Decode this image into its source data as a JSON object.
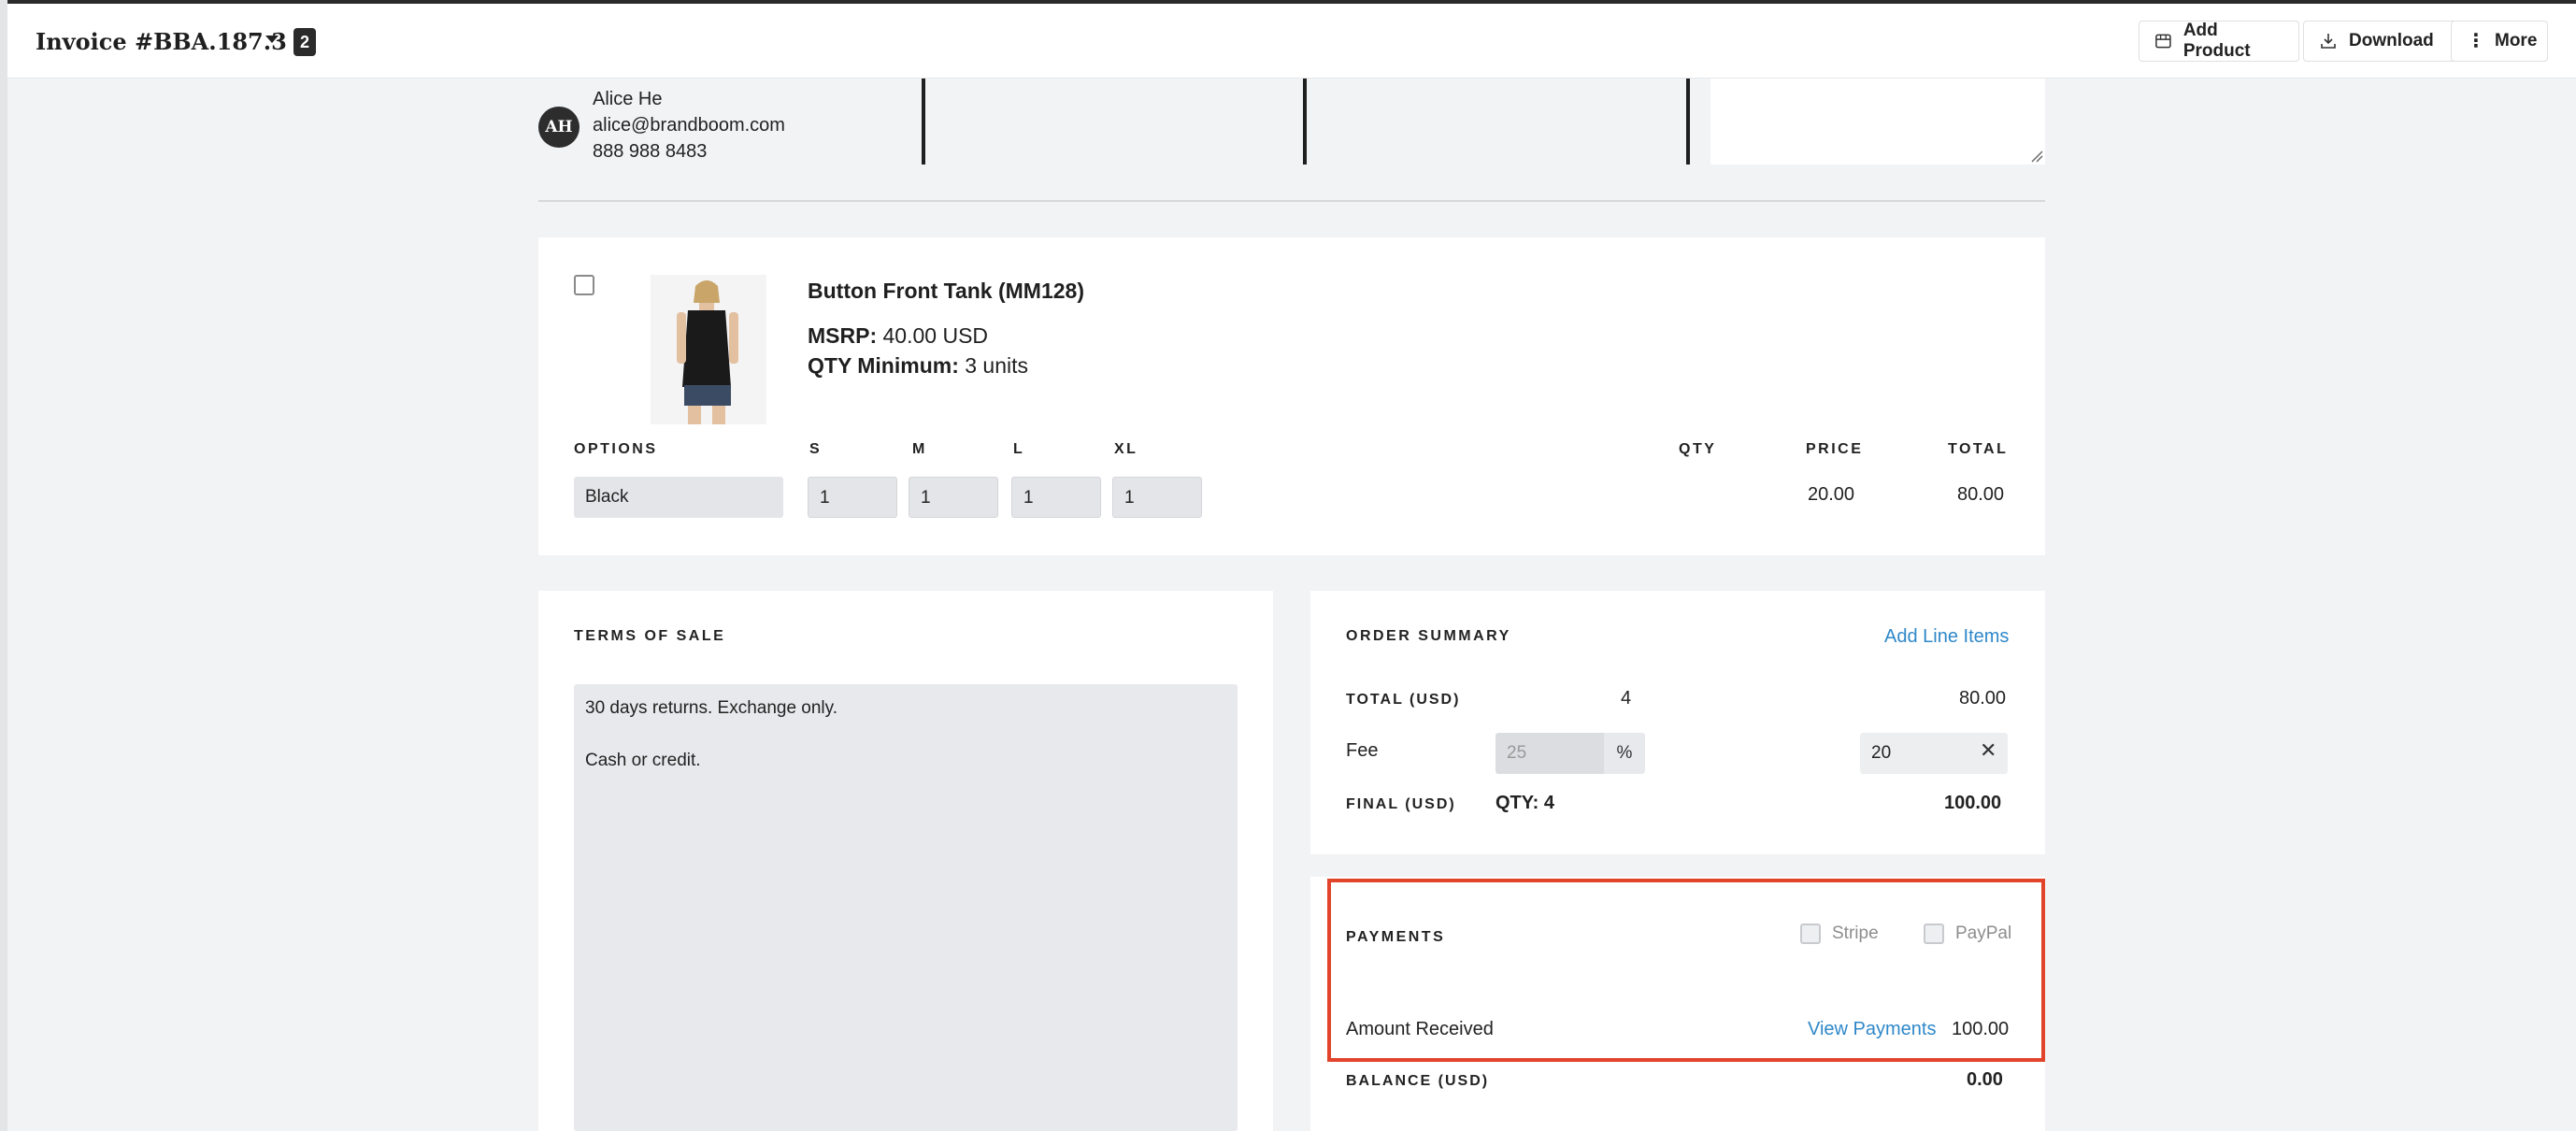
{
  "header": {
    "invoice_title": "Invoice #BBA.187.3",
    "badge_count": "2",
    "buttons": {
      "add_product": "Add Product",
      "download": "Download",
      "more": "More"
    }
  },
  "contact": {
    "initials": "AH",
    "name": "Alice He",
    "email": "alice@brandboom.com",
    "phone": "888 988 8483"
  },
  "product": {
    "name": "Button Front Tank (MM128)",
    "msrp_label": "MSRP:",
    "msrp_value": "40.00 USD",
    "qty_min_label": "QTY Minimum:",
    "qty_min_value": "3 units",
    "columns": {
      "options": "OPTIONS",
      "sizes": [
        "S",
        "M",
        "L",
        "XL"
      ],
      "qty": "QTY",
      "price": "PRICE",
      "total": "TOTAL"
    },
    "option_value": "Black",
    "size_quantities": [
      "1",
      "1",
      "1",
      "1"
    ],
    "price": "20.00",
    "total": "80.00"
  },
  "terms": {
    "title": "TERMS OF SALE",
    "line1": "30 days returns. Exchange only.",
    "line2": "Cash or credit."
  },
  "summary": {
    "title": "ORDER SUMMARY",
    "add_line_items": "Add Line Items",
    "total_label": "TOTAL (USD)",
    "total_qty": "4",
    "total_value": "80.00",
    "fee_label": "Fee",
    "fee_percent_placeholder": "25",
    "percent_sign": "%",
    "fee_amount": "20",
    "final_label": "FINAL (USD)",
    "final_qty": "QTY: 4",
    "final_value": "100.00"
  },
  "payments": {
    "title": "PAYMENTS",
    "stripe": "Stripe",
    "paypal": "PayPal",
    "amount_received_label": "Amount Received",
    "view_payments": "View Payments",
    "amount_received_value": "100.00",
    "balance_label": "BALANCE (USD)",
    "balance_value": "0.00"
  },
  "colors": {
    "accent_link": "#2f88c9",
    "highlight": "#e2442b"
  }
}
